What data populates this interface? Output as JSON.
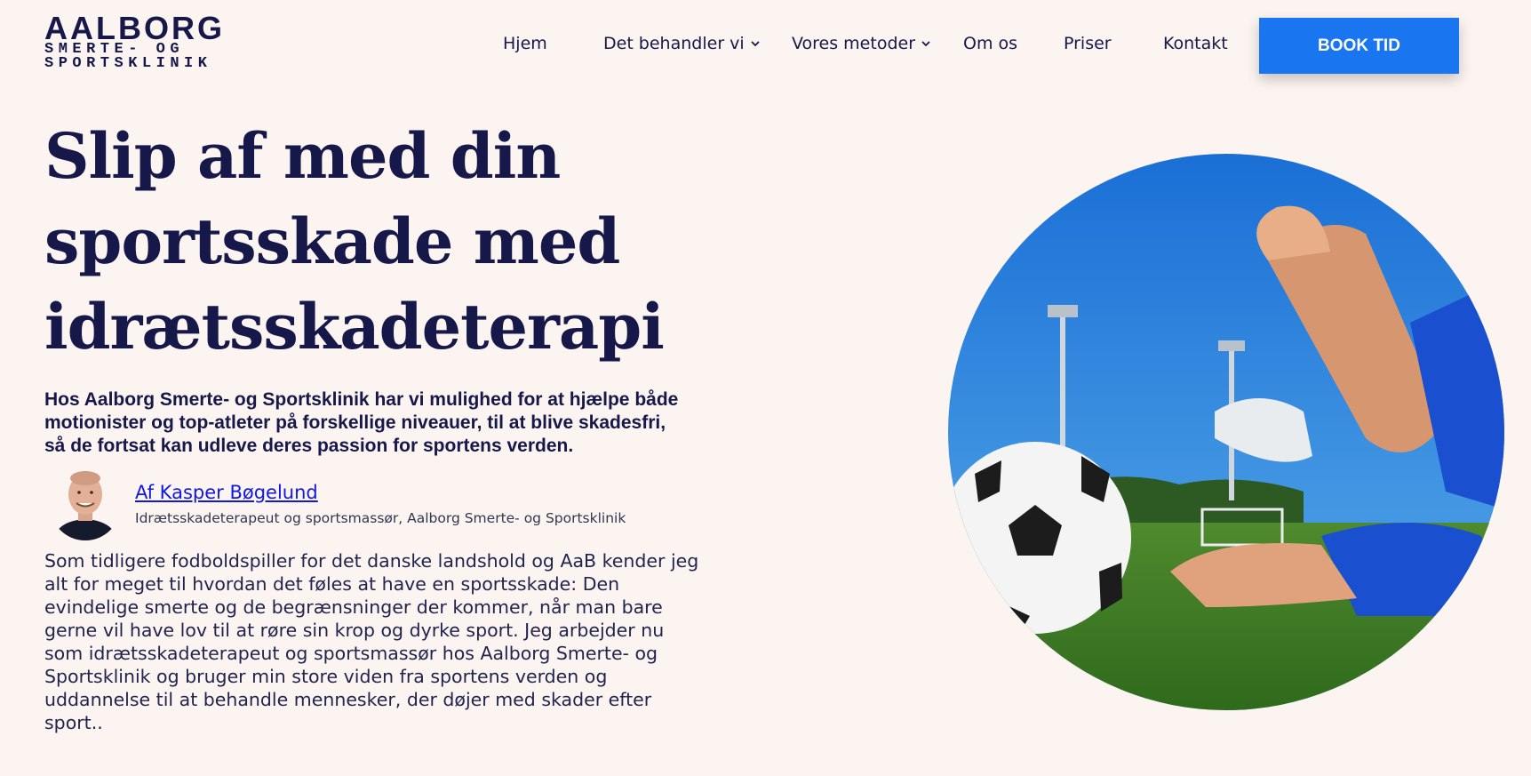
{
  "logo": {
    "line1": "AALBORG",
    "line2": "SMERTE- OG",
    "line3": "SPORTSKLINIK"
  },
  "nav": {
    "items": [
      {
        "label": "Hjem",
        "has_dropdown": false
      },
      {
        "label": "Det behandler vi",
        "has_dropdown": true
      },
      {
        "label": "Vores metoder",
        "has_dropdown": true
      },
      {
        "label": "Om os",
        "has_dropdown": false
      },
      {
        "label": "Priser",
        "has_dropdown": false
      },
      {
        "label": "Kontakt",
        "has_dropdown": false
      }
    ],
    "cta_label": "BOOK TID"
  },
  "hero": {
    "title_lines": [
      "Slip af med din",
      "sportsskade med",
      "idrætsskadeterapi"
    ],
    "lead_lines": [
      "Hos Aalborg Smerte- og Sportsklinik har vi mulighed for at hjælpe både",
      "motionister og top-atleter på forskellige niveauer, til at blive skadesfri,",
      "så de fortsat kan udleve deres passion for sportens verden."
    ],
    "author": {
      "name": "Af Kasper Bøgelund",
      "role": "Idrætsskadeterapeut og sportsmassør, Aalborg Smerte- og Sportsklinik"
    },
    "body_lines": [
      "Som tidligere fodboldspiller for det danske landshold og AaB kender jeg",
      "alt for meget til hvordan det føles at have en sportsskade: Den",
      "evindelige smerte og de begrænsninger der kommer, når man bare",
      "gerne vil have lov til at røre sin krop og dyrke sport. Jeg arbejder nu",
      "som idrætsskadeterapeut og sportsmassør hos Aalborg Smerte- og",
      "Sportsklinik og bruger min store viden fra sportens verden og",
      "uddannelse til at behandle mennesker, der døjer med skader efter",
      "sport.."
    ]
  },
  "colors": {
    "background": "#fcf4f1",
    "navy": "#16184a",
    "cta": "#1a75f0",
    "link": "#0f18e6"
  },
  "icons": {
    "dropdown": "chevron-down-icon"
  }
}
